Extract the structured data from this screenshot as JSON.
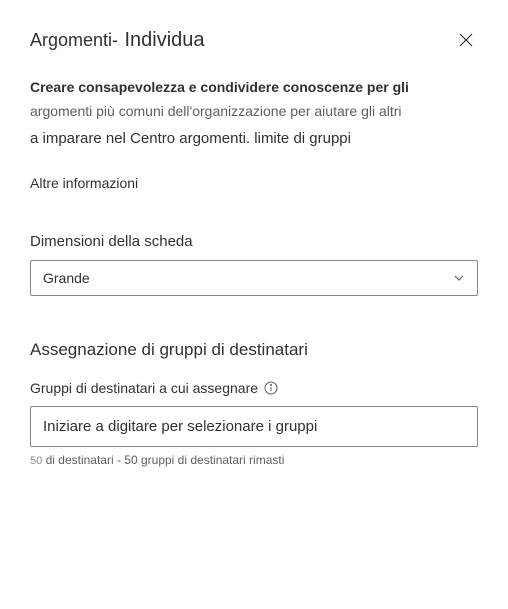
{
  "header": {
    "title_prefix": "Argomenti-",
    "title_main": "Individua"
  },
  "description": {
    "line1": "Creare consapevolezza e condividere conoscenze per gli",
    "line2": "argomenti più comuni dell'organizzazione per aiutare gli altri",
    "line3": "a imparare nel Centro argomenti. limite di gruppi"
  },
  "more_info": "Altre informazioni",
  "card_size": {
    "label": "Dimensioni della scheda",
    "value": "Grande"
  },
  "audience": {
    "heading": "Assegnazione di gruppi di destinatari",
    "field_label": "Gruppi di destinatari a cui assegnare",
    "placeholder": "Iniziare a digitare per selezionare i gruppi",
    "helper_count": "50",
    "helper_text": "di destinatari - 50 gruppi di destinatari rimasti"
  }
}
